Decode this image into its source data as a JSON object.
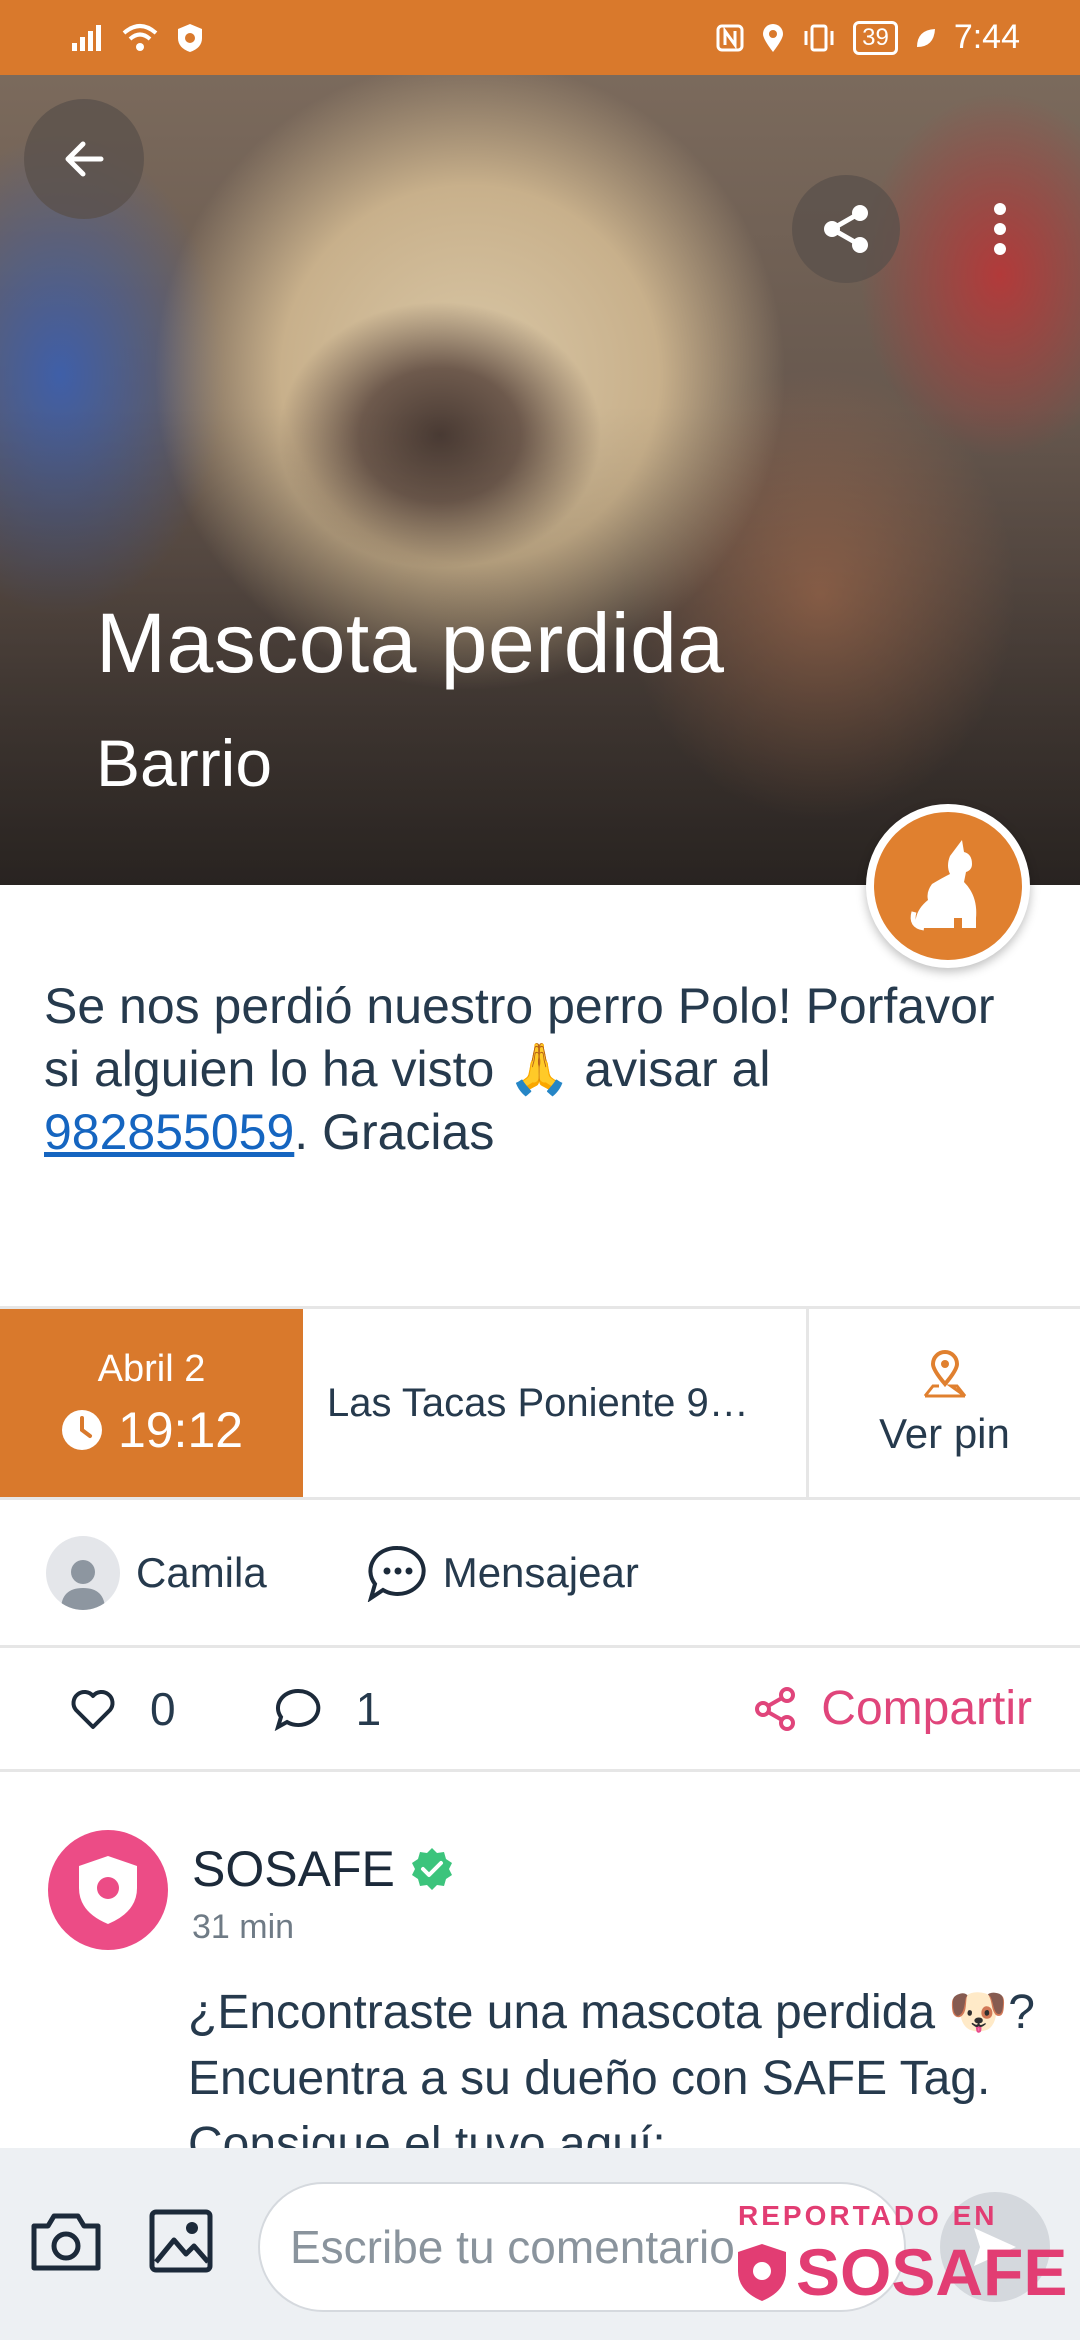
{
  "status_bar": {
    "time": "7:44",
    "battery": "39"
  },
  "hero": {
    "title": "Mascota perdida",
    "subtitle": "Barrio"
  },
  "description": {
    "text_before": "Se nos perdió nuestro perro Polo! Porfavor si alguien lo ha visto 🙏 avisar al ",
    "phone": "982855059",
    "text_after": ". Gracias"
  },
  "info": {
    "date": "Abril 2",
    "time": "19:12",
    "address": "Las Tacas Poniente  9…",
    "pin_label": "Ver pin"
  },
  "user": {
    "name": "Camila",
    "message_label": "Mensajear"
  },
  "stats": {
    "likes": "0",
    "comments": "1",
    "share_label": "Compartir"
  },
  "comment": {
    "author": "SOSAFE",
    "time": "31 min",
    "text": "¿Encontraste una mascota perdida 🐶? Encuentra a su dueño con SAFE Tag. Consigue el tuyo aquí:"
  },
  "composer": {
    "placeholder": "Escribe tu comentario..."
  },
  "watermark": {
    "line1": "REPORTADO EN",
    "line2": "SOSAFE"
  },
  "colors": {
    "accent": "#d9792c",
    "brand_pink": "#e0457b",
    "link": "#1565c0"
  }
}
